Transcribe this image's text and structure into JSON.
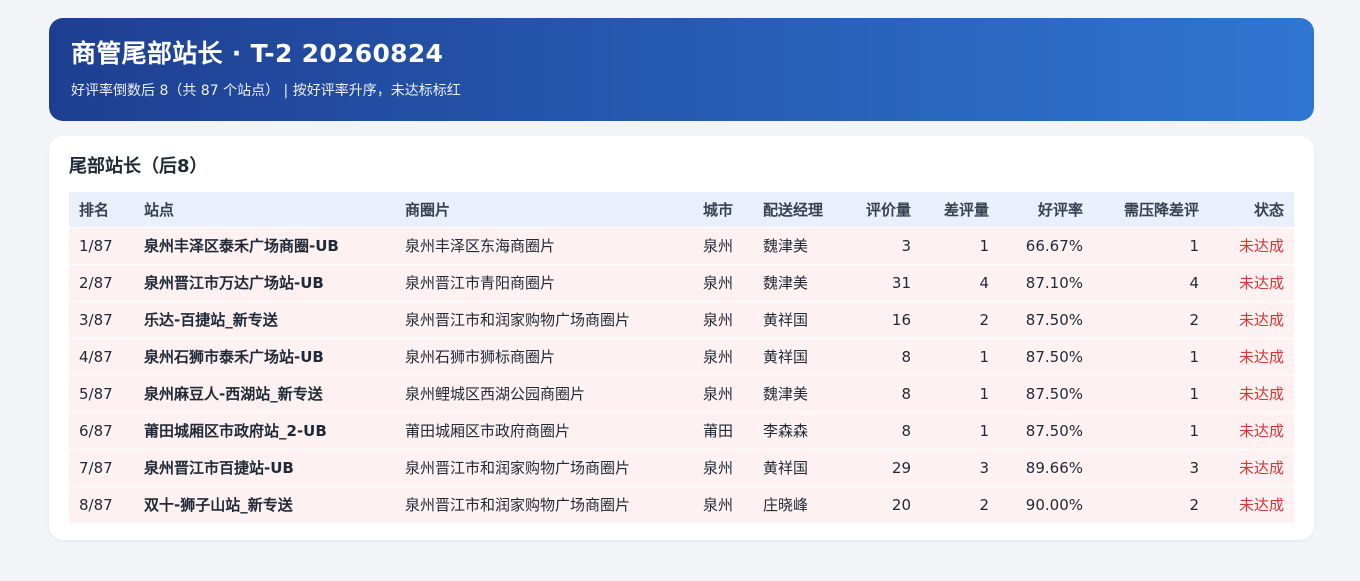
{
  "header": {
    "title": "商管尾部站长 · T-2 20260824",
    "subtitle": "好评率倒数后 8（共 87 个站点） | 按好评率升序，未达标标红"
  },
  "section": {
    "title": "尾部站长（后8）"
  },
  "table": {
    "columns": [
      "排名",
      "站点",
      "商圈片",
      "城市",
      "配送经理",
      "评价量",
      "差评量",
      "好评率",
      "需压降差评",
      "状态"
    ],
    "rows": [
      [
        "1/87",
        "泉州丰泽区泰禾广场商圈-UB",
        "泉州丰泽区东海商圈片",
        "泉州",
        "魏津美",
        "3",
        "1",
        "66.67%",
        "1",
        "未达成"
      ],
      [
        "2/87",
        "泉州晋江市万达广场站-UB",
        "泉州晋江市青阳商圈片",
        "泉州",
        "魏津美",
        "31",
        "4",
        "87.10%",
        "4",
        "未达成"
      ],
      [
        "3/87",
        "乐达-百捷站_新专送",
        "泉州晋江市和润家购物广场商圈片",
        "泉州",
        "黄祥国",
        "16",
        "2",
        "87.50%",
        "2",
        "未达成"
      ],
      [
        "4/87",
        "泉州石狮市泰禾广场站-UB",
        "泉州石狮市狮标商圈片",
        "泉州",
        "黄祥国",
        "8",
        "1",
        "87.50%",
        "1",
        "未达成"
      ],
      [
        "5/87",
        "泉州麻豆人-西湖站_新专送",
        "泉州鲤城区西湖公园商圈片",
        "泉州",
        "魏津美",
        "8",
        "1",
        "87.50%",
        "1",
        "未达成"
      ],
      [
        "6/87",
        "莆田城厢区市政府站_2-UB",
        "莆田城厢区市政府商圈片",
        "莆田",
        "李森森",
        "8",
        "1",
        "87.50%",
        "1",
        "未达成"
      ],
      [
        "7/87",
        "泉州晋江市百捷站-UB",
        "泉州晋江市和润家购物广场商圈片",
        "泉州",
        "黄祥国",
        "29",
        "3",
        "89.66%",
        "3",
        "未达成"
      ],
      [
        "8/87",
        "双十-狮子山站_新专送",
        "泉州晋江市和润家购物广场商圈片",
        "泉州",
        "庄晓峰",
        "20",
        "2",
        "90.00%",
        "2",
        "未达成"
      ]
    ]
  },
  "colors": {
    "header_start": "#1e3f91",
    "header_end": "#2f76d2",
    "row_bg": "#fdf1f1",
    "head_bg": "#eaf0fb",
    "status_red": "#d93636"
  }
}
